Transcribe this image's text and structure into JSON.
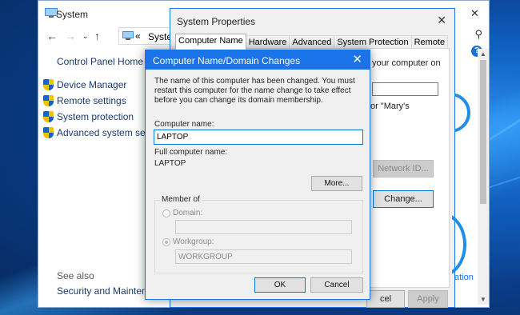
{
  "system_window": {
    "title": "System",
    "address_chevron": "«",
    "address_text": "System and",
    "control_panel_home": "Control Panel Home",
    "links": [
      {
        "label": "Device Manager"
      },
      {
        "label": "Remote settings"
      },
      {
        "label": "System protection"
      },
      {
        "label": "Advanced system settings"
      }
    ],
    "see_also": "See also",
    "security_maintenance": "Security and Maintenance",
    "controls": {
      "minimize": "—",
      "maximize": "☐",
      "close": "✕"
    },
    "help": "?"
  },
  "properties_window": {
    "title": "System Properties",
    "tabs": [
      {
        "label": "Computer Name",
        "active": true
      },
      {
        "label": "Hardware"
      },
      {
        "label": "Advanced"
      },
      {
        "label": "System Protection"
      },
      {
        "label": "Remote"
      }
    ],
    "partial_text_1": "your computer on",
    "partial_text_2": "\" or \"Mary's",
    "network_id_button": "Network ID...",
    "change_button": "Change...",
    "partial_action": "ation",
    "cancel_partial": "cel",
    "apply_button": "Apply"
  },
  "dialog": {
    "title": "Computer Name/Domain Changes",
    "message": "The name of this computer has been changed.  You must restart this computer for the name change to take effect before you can change its domain membership.",
    "computer_name_label": "Computer name:",
    "computer_name_value": "LAPTOP",
    "full_name_label": "Full computer name:",
    "full_name_value": "LAPTOP",
    "more_button": "More...",
    "member_of": "Member of",
    "domain_label": "Domain:",
    "domain_value": "",
    "workgroup_label": "Workgroup:",
    "workgroup_value": "WORKGROUP",
    "ok_button": "OK",
    "cancel_button": "Cancel",
    "close": "✕"
  },
  "colors": {
    "accent": "#1a73e8",
    "link": "#1a3a6a",
    "desktop": "#0a3a78"
  }
}
